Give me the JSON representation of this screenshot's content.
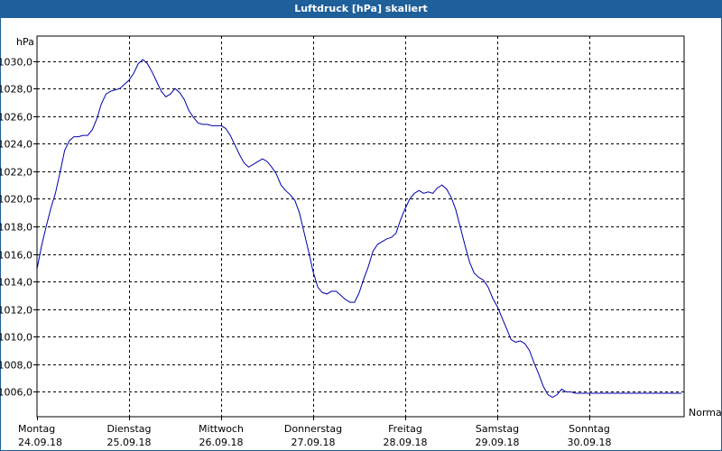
{
  "window": {
    "title": "Luftdruck [hPa] skaliert"
  },
  "chart_data": {
    "type": "line",
    "title": "Luftdruck [hPa] skaliert",
    "ylabel": "hPa",
    "x_end_label": "Normal",
    "ylim": [
      1004.2,
      1031.8
    ],
    "xlim": [
      0,
      7
    ],
    "y_ticks": [
      "1030,0",
      "1028,0",
      "1026,0",
      "1024,0",
      "1022,0",
      "1020,0",
      "1018,0",
      "1016,0",
      "1014,0",
      "1012,0",
      "1010,0",
      "1008,0",
      "1006,0"
    ],
    "y_tick_values": [
      1030,
      1028,
      1026,
      1024,
      1022,
      1020,
      1018,
      1016,
      1014,
      1012,
      1010,
      1008,
      1006
    ],
    "x_ticks": [
      {
        "day": "Montag",
        "date": "24.09.18",
        "x": 0
      },
      {
        "day": "Dienstag",
        "date": "25.09.18",
        "x": 1
      },
      {
        "day": "Mittwoch",
        "date": "26.09.18",
        "x": 2
      },
      {
        "day": "Donnerstag",
        "date": "27.09.18",
        "x": 3
      },
      {
        "day": "Freitag",
        "date": "28.09.18",
        "x": 4
      },
      {
        "day": "Samstag",
        "date": "29.09.18",
        "x": 5
      },
      {
        "day": "Sonntag",
        "date": "30.09.18",
        "x": 6
      }
    ],
    "grid": true,
    "series": [
      {
        "color": "#0000aa",
        "x": [
          0,
          0.05,
          0.1,
          0.15,
          0.2,
          0.25,
          0.3,
          0.35,
          0.4,
          0.45,
          0.5,
          0.55,
          0.6,
          0.65,
          0.7,
          0.75,
          0.8,
          0.85,
          0.9,
          0.95,
          1.0,
          1.05,
          1.1,
          1.15,
          1.2,
          1.25,
          1.3,
          1.35,
          1.4,
          1.45,
          1.5,
          1.55,
          1.6,
          1.65,
          1.7,
          1.75,
          1.8,
          1.85,
          1.9,
          1.95,
          2.0,
          2.05,
          2.1,
          2.15,
          2.2,
          2.25,
          2.3,
          2.35,
          2.4,
          2.45,
          2.5,
          2.55,
          2.6,
          2.65,
          2.7,
          2.75,
          2.8,
          2.85,
          2.9,
          2.95,
          3.0,
          3.05,
          3.1,
          3.15,
          3.2,
          3.25,
          3.3,
          3.35,
          3.4,
          3.45,
          3.5,
          3.55,
          3.6,
          3.65,
          3.7,
          3.75,
          3.8,
          3.85,
          3.9,
          3.95,
          4.0,
          4.05,
          4.1,
          4.15,
          4.2,
          4.25,
          4.3,
          4.35,
          4.4,
          4.45,
          4.5,
          4.55,
          4.6,
          4.65,
          4.7,
          4.75,
          4.8,
          4.85,
          4.9,
          4.95,
          5.0,
          5.05,
          5.1,
          5.15,
          5.2,
          5.25,
          5.3,
          5.35,
          5.4,
          5.45,
          5.5,
          5.55,
          5.6,
          5.65,
          5.7,
          5.75,
          5.8,
          5.85,
          5.9,
          5.95,
          6.0,
          6.05,
          6.1,
          6.15,
          6.2,
          6.25,
          6.3,
          6.35,
          6.4,
          6.45,
          6.5,
          6.55,
          6.6,
          6.65,
          6.7,
          6.75,
          6.8,
          6.85,
          6.9,
          6.95,
          7.0
        ],
        "y": [
          1014.9,
          1016.6,
          1018.0,
          1019.3,
          1020.4,
          1021.9,
          1023.5,
          1024.2,
          1024.5,
          1024.5,
          1024.6,
          1024.6,
          1025.0,
          1025.8,
          1026.9,
          1027.6,
          1027.8,
          1027.9,
          1028.0,
          1028.3,
          1028.6,
          1029.1,
          1029.8,
          1030.1,
          1029.8,
          1029.2,
          1028.5,
          1027.8,
          1027.4,
          1027.6,
          1028.0,
          1027.7,
          1027.2,
          1026.4,
          1025.9,
          1025.5,
          1025.4,
          1025.4,
          1025.3,
          1025.3,
          1025.3,
          1025.1,
          1024.6,
          1023.9,
          1023.2,
          1022.6,
          1022.3,
          1022.5,
          1022.7,
          1022.9,
          1022.7,
          1022.3,
          1021.8,
          1021.0,
          1020.6,
          1020.3,
          1019.9,
          1019.0,
          1017.6,
          1016.2,
          1014.7,
          1013.6,
          1013.2,
          1013.1,
          1013.3,
          1013.3,
          1013.0,
          1012.7,
          1012.5,
          1012.5,
          1013.2,
          1014.2,
          1015.1,
          1016.2,
          1016.7,
          1016.9,
          1017.1,
          1017.2,
          1017.5,
          1018.5,
          1019.3,
          1020.0,
          1020.4,
          1020.6,
          1020.4,
          1020.5,
          1020.4,
          1020.8,
          1021.0,
          1020.7,
          1020.1,
          1019.2,
          1017.9,
          1016.6,
          1015.4,
          1014.6,
          1014.3,
          1014.1,
          1013.6,
          1012.8,
          1012.2,
          1011.4,
          1010.6,
          1009.8,
          1009.6,
          1009.7,
          1009.5,
          1009.0,
          1008.1,
          1007.3,
          1006.4,
          1005.8,
          1005.6,
          1005.8,
          1006.2,
          1006.0,
          1006.0,
          1005.9,
          1005.9,
          1005.9,
          1005.9,
          1005.9,
          1005.9,
          1005.9,
          1005.9,
          1005.9,
          1005.9,
          1005.9,
          1005.9,
          1005.9,
          1005.9,
          1005.9,
          1005.9,
          1005.9,
          1005.9,
          1005.9,
          1005.9,
          1005.9,
          1005.9,
          1005.9,
          1005.9
        ]
      }
    ]
  }
}
